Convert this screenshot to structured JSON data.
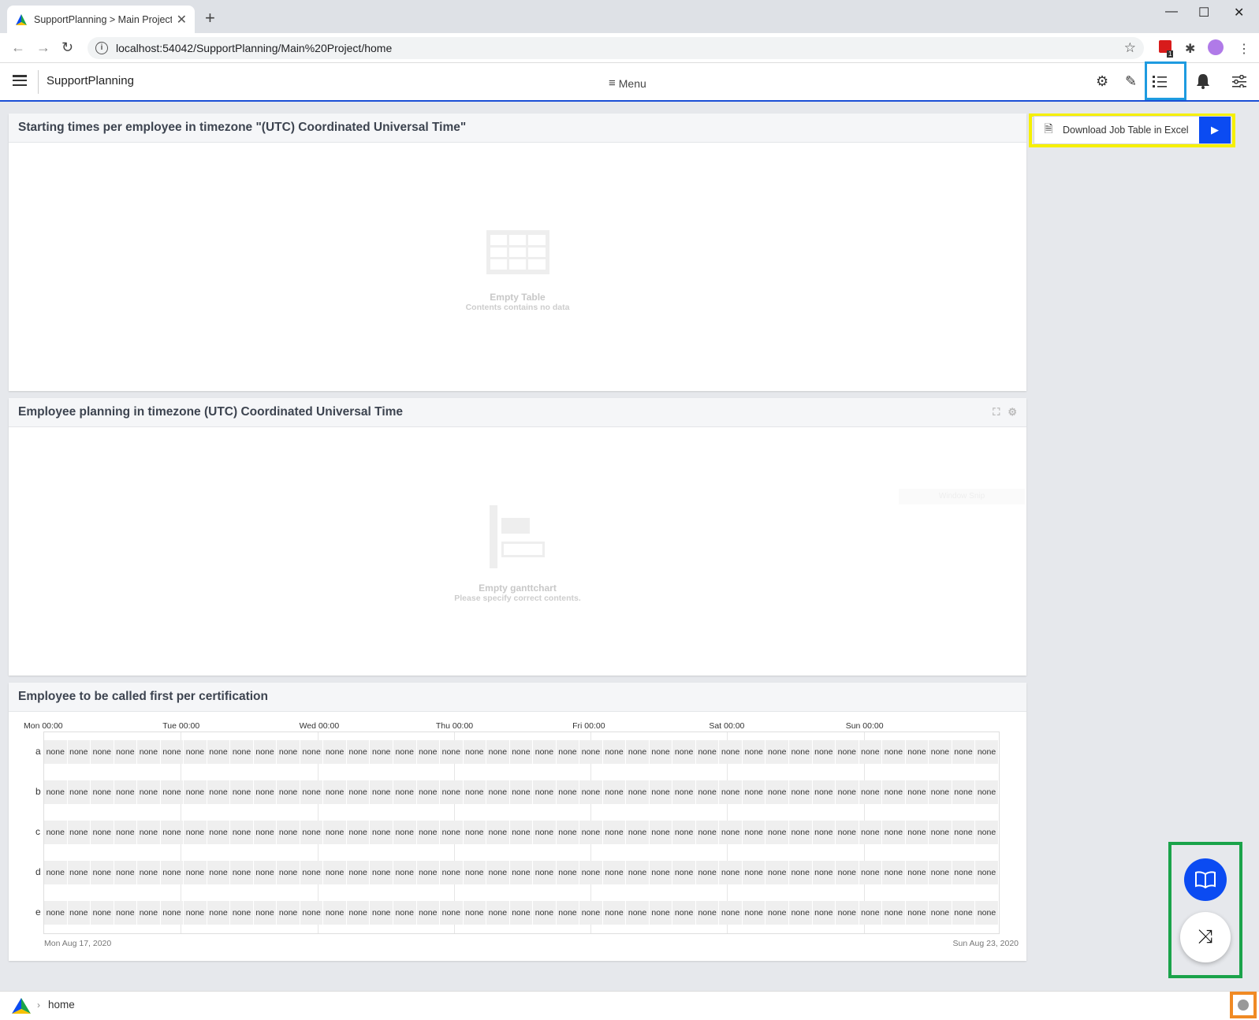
{
  "browser": {
    "tab_title": "SupportPlanning > Main Project/",
    "tab_close": "✕",
    "new_tab": "+",
    "url": "localhost:54042/SupportPlanning/Main%20Project/home",
    "window_controls": [
      "—",
      "☐",
      "✕"
    ],
    "extension_badge": "1"
  },
  "header": {
    "app_name": "SupportPlanning",
    "menu_label": "Menu"
  },
  "panels": {
    "starting_times": {
      "title": "Starting times per employee in timezone \"(UTC) Coordinated Universal Time\"",
      "empty_title": "Empty Table",
      "empty_sub": "Contents contains no data"
    },
    "employee_planning": {
      "title": "Employee planning in timezone (UTC) Coordinated Universal Time",
      "empty_title": "Empty ganttchart",
      "empty_sub": "Please specify correct contents.",
      "ghost_text": "Window Snip"
    },
    "called_first": {
      "title": "Employee to be called first per certification",
      "days": [
        "Mon 00:00",
        "Tue 00:00",
        "Wed 00:00",
        "Thu 00:00",
        "Fri 00:00",
        "Sat 00:00",
        "Sun 00:00"
      ],
      "rows": [
        "a",
        "b",
        "c",
        "d",
        "e"
      ],
      "cell_value": "none",
      "cells_per_row": 41,
      "start_date": "Mon Aug 17, 2020",
      "end_date": "Sun Aug 23, 2020"
    }
  },
  "actions": {
    "download_label": "Download Job Table in Excel"
  },
  "footer": {
    "breadcrumb": "home"
  },
  "colors": {
    "accent_blue": "#0b4bf2",
    "highlight_yellow": "#f6f000",
    "highlight_blue": "#1e9be0",
    "highlight_green": "#1aa34a",
    "highlight_orange": "#f08a24"
  }
}
